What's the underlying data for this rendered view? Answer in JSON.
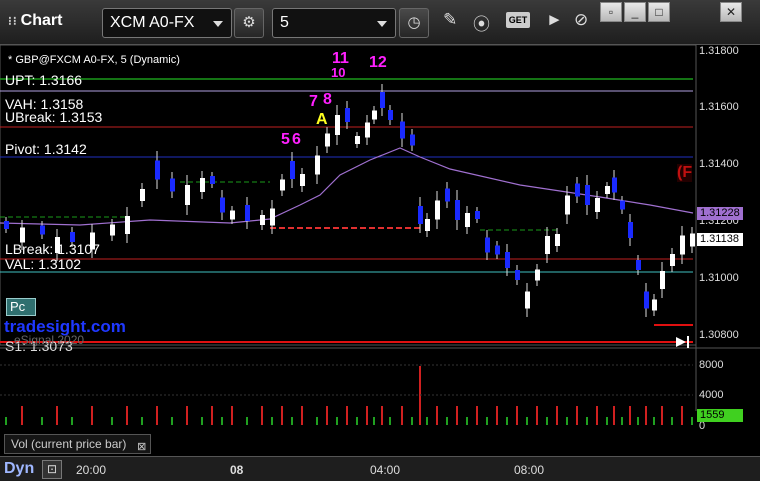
{
  "toolbar": {
    "app_title": "Chart",
    "symbol": "XCM A0-FX",
    "interval": "5",
    "get_label": "GET"
  },
  "chart": {
    "header": "* GBP@FXCM A0-FX, 5 (Dynamic)",
    "levels": {
      "upt": "UPT: 1.3166",
      "vah": "VAH: 1.3158",
      "ubreak": "UBreak: 1.3153",
      "pivot": "Pivot: 1.3142",
      "lbreak": "LBreak: 1.3107",
      "val": "VAL: 1.3102",
      "s1": "S1: 1.3073"
    },
    "pc_label": "Pc",
    "watermark": "tradesight.com",
    "copyright": "eSignal 2020",
    "markers": {
      "m11": "11",
      "m10": "10",
      "m12": "12",
      "m7": "7",
      "m8": "8",
      "a": "A",
      "m5": "5",
      "m6": "6",
      "f": "(F"
    },
    "price_axis": [
      "1.31800",
      "1.31600",
      "1.31400",
      "1.31200",
      "1.31000",
      "1.30800"
    ],
    "price_tags": {
      "upper": "1.31228",
      "lower": "1.31138"
    },
    "volume_axis": [
      "8000",
      "4000",
      "0"
    ],
    "volume_tag": "1559",
    "volume_label": "Vol (current price bar)",
    "close_symbol": "⊠",
    "time_axis": [
      "20:00",
      "08",
      "04:00",
      "08:00"
    ],
    "dyn_label": "Dyn",
    "colors": {
      "upt": "#1a9a1a",
      "vah": "#b0a0e0",
      "ubreak": "#c02020",
      "pivot": "#2030c0",
      "val": "#40c0c0",
      "s1": "#e01010",
      "bar": "#ffffff",
      "bar_down": "#1a2aff",
      "ma": "#a070d0",
      "marker_magenta": "#ff20ff",
      "marker_yellow": "#ffff20",
      "volume_tag": "#40d020",
      "upper_tag": "#a070d0",
      "lower_tag": "#ffffff"
    }
  }
}
